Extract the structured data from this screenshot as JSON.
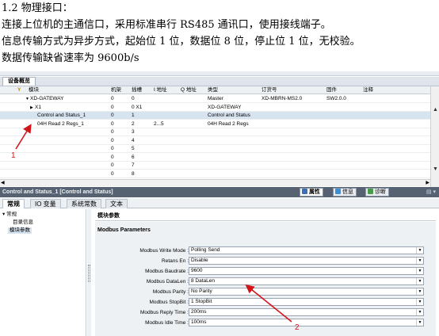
{
  "doc": {
    "heading": "1.2 物理接口：",
    "lines": [
      "连接上位机的主通信口，采用标准串行 RS485 通讯口，使用接线端子。",
      "信息传输方式为异步方式，起始位 1 位，数据位 8 位，停止位 1 位，无校验。",
      "数据传输缺省速率为 9600b/s"
    ]
  },
  "device_overview": {
    "tab_label": "设备概览",
    "columns": [
      "模块",
      "机架",
      "插槽",
      "I 地址",
      "Q 地址",
      "类型",
      "订货号",
      "固件",
      "注释"
    ],
    "rows": [
      {
        "module": "XD-GATEWAY",
        "rack": "0",
        "slot": "0",
        "i_addr": "",
        "q_addr": "",
        "type": "Master",
        "order": "XD-MBRN-MS2.0",
        "firmware": "SW2.0.0",
        "comment": "",
        "prefix": "▼"
      },
      {
        "module": "X1",
        "rack": "0",
        "slot": "0 X1",
        "i_addr": "",
        "q_addr": "",
        "type": "XD-GATEWAY",
        "order": "",
        "firmware": "",
        "comment": "",
        "prefix": "▶"
      },
      {
        "module": "Control and Status_1",
        "rack": "0",
        "slot": "1",
        "i_addr": "",
        "q_addr": "",
        "type": "Control and Status",
        "order": "",
        "firmware": "",
        "comment": "",
        "prefix": ""
      },
      {
        "module": "04H Read 2 Regs_1",
        "rack": "0",
        "slot": "2",
        "i_addr": "2...5",
        "q_addr": "",
        "type": "04H Read 2 Regs",
        "order": "",
        "firmware": "",
        "comment": "",
        "prefix": ""
      },
      {
        "module": "",
        "rack": "0",
        "slot": "3",
        "i_addr": "",
        "q_addr": "",
        "type": "",
        "order": "",
        "firmware": "",
        "comment": "",
        "prefix": ""
      },
      {
        "module": "",
        "rack": "0",
        "slot": "4",
        "i_addr": "",
        "q_addr": "",
        "type": "",
        "order": "",
        "firmware": "",
        "comment": "",
        "prefix": ""
      },
      {
        "module": "",
        "rack": "0",
        "slot": "5",
        "i_addr": "",
        "q_addr": "",
        "type": "",
        "order": "",
        "firmware": "",
        "comment": "",
        "prefix": ""
      },
      {
        "module": "",
        "rack": "0",
        "slot": "6",
        "i_addr": "",
        "q_addr": "",
        "type": "",
        "order": "",
        "firmware": "",
        "comment": "",
        "prefix": ""
      },
      {
        "module": "",
        "rack": "0",
        "slot": "7",
        "i_addr": "",
        "q_addr": "",
        "type": "",
        "order": "",
        "firmware": "",
        "comment": "",
        "prefix": ""
      },
      {
        "module": "",
        "rack": "0",
        "slot": "8",
        "i_addr": "",
        "q_addr": "",
        "type": "",
        "order": "",
        "firmware": "",
        "comment": "",
        "prefix": ""
      }
    ]
  },
  "properties": {
    "title": "Control and Status_1 [Control and Status]",
    "inspector_tabs": [
      {
        "label": "属性",
        "icon": "properties-icon"
      },
      {
        "label": "信息",
        "icon": "info-icon"
      },
      {
        "label": "诊断",
        "icon": "diagnostics-icon"
      }
    ],
    "sub_tabs": [
      "常规",
      "IO 变量",
      "系统常数",
      "文本"
    ],
    "nav": {
      "root": "常规",
      "child": "目录信息",
      "selected": "模块参数"
    },
    "section_title": "模块参数",
    "group_title": "Modbus Parameters",
    "params": [
      {
        "label": "Modbus Write Mode :",
        "value": "Polling Send"
      },
      {
        "label": "Retans En :",
        "value": "Disable"
      },
      {
        "label": "Modbus Baudrate :",
        "value": "9600"
      },
      {
        "label": "Modbus DataLen :",
        "value": "8 DataLen"
      },
      {
        "label": "Modbus Parity :",
        "value": "No Parity"
      },
      {
        "label": "Modbus StopBit :",
        "value": "1 StopBit"
      },
      {
        "label": "Modbus Reply Time :",
        "value": "200ms"
      },
      {
        "label": "Modbus Idle Time :",
        "value": "100ms"
      }
    ]
  },
  "annotations": {
    "marker1": "1",
    "marker2": "2",
    "color": "#d2141b"
  }
}
